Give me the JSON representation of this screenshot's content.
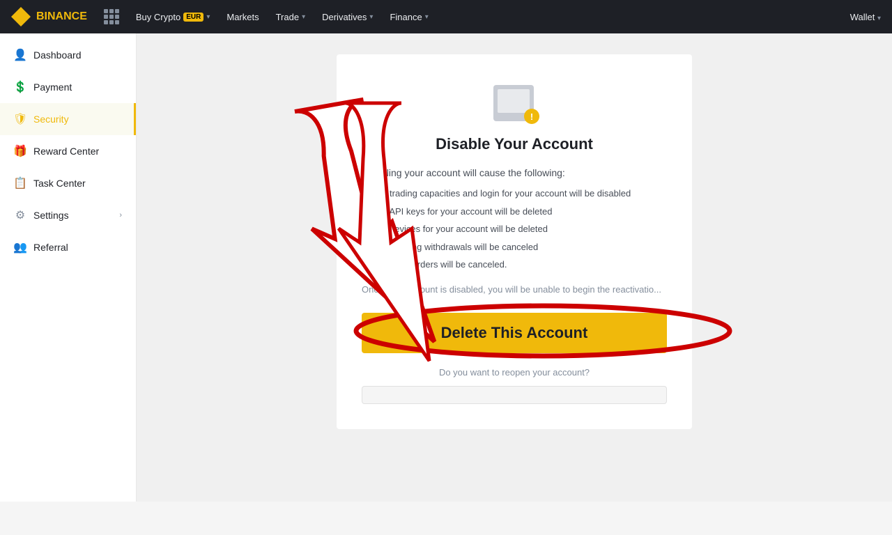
{
  "brand": {
    "name": "BINANCE",
    "logoAlt": "Binance logo"
  },
  "topnav": {
    "items": [
      {
        "label": "Buy Crypto",
        "badge": "EUR",
        "hasDropdown": true
      },
      {
        "label": "Markets",
        "hasDropdown": false
      },
      {
        "label": "Trade",
        "hasDropdown": true
      },
      {
        "label": "Derivatives",
        "hasDropdown": true
      },
      {
        "label": "Finance",
        "hasDropdown": true
      }
    ],
    "wallet_label": "Wallet"
  },
  "sidebar": {
    "items": [
      {
        "id": "dashboard",
        "label": "Dashboard",
        "icon": "👤"
      },
      {
        "id": "payment",
        "label": "Payment",
        "icon": "💲"
      },
      {
        "id": "security",
        "label": "Security",
        "icon": "🛡",
        "active": true
      },
      {
        "id": "reward-center",
        "label": "Reward Center",
        "icon": "🎁"
      },
      {
        "id": "task-center",
        "label": "Task Center",
        "icon": "📋"
      },
      {
        "id": "settings",
        "label": "Settings",
        "icon": "⚙",
        "hasArrow": true
      },
      {
        "id": "referral",
        "label": "Referral",
        "icon": "👥"
      }
    ]
  },
  "card": {
    "title": "Disable Your Account",
    "subtitle": "Disabling your account will cause the following:",
    "consequences": [
      "All trading capacities and login for your account will be disabled",
      "All API keys for your account will be deleted",
      "All devices for your account will be deleted",
      "All pending withdrawals will be canceled",
      "All open orders will be canceled."
    ],
    "note": "Once your account is disabled, you will be unable to begin the reactivatio...",
    "delete_button_label": "Delete This Account",
    "question_text": "Do you want to reopen your account?",
    "cancel_button_label": ""
  }
}
